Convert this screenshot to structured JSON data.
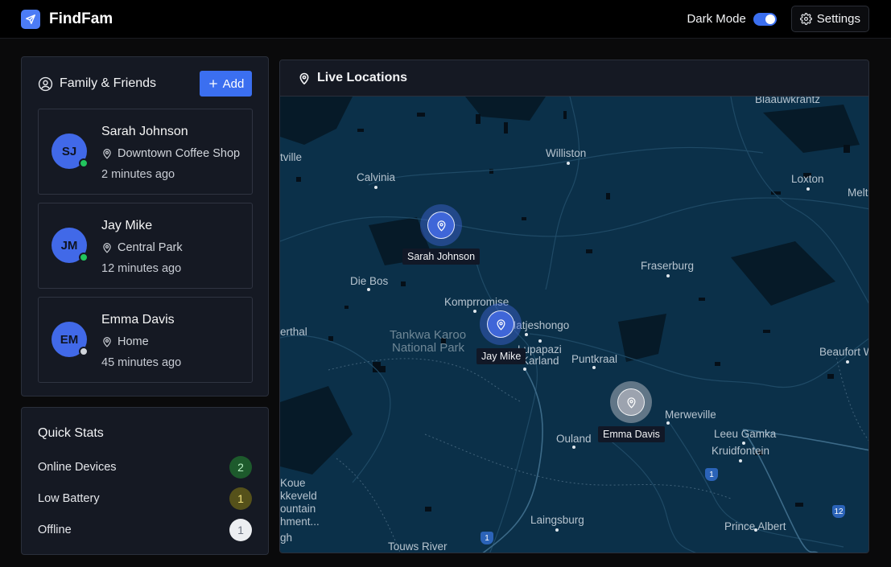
{
  "app": {
    "name": "FindFam"
  },
  "header": {
    "dark_mode_label": "Dark Mode",
    "dark_mode_on": true,
    "settings_label": "Settings"
  },
  "family_panel": {
    "title": "Family & Friends",
    "add_label": "Add",
    "members": [
      {
        "initials": "SJ",
        "name": "Sarah Johnson",
        "location": "Downtown Coffee Shop",
        "time": "2 minutes ago",
        "status": "online",
        "status_color": "#22c55e"
      },
      {
        "initials": "JM",
        "name": "Jay Mike",
        "location": "Central Park",
        "time": "12 minutes ago",
        "status": "online",
        "status_color": "#22c55e"
      },
      {
        "initials": "EM",
        "name": "Emma Davis",
        "location": "Home",
        "time": "45 minutes ago",
        "status": "offline",
        "status_color": "#d1d5db"
      }
    ]
  },
  "quick_stats": {
    "title": "Quick Stats",
    "rows": [
      {
        "label": "Online Devices",
        "value": "2",
        "bg": "#1d5a2c",
        "fg": "#b8f0c4"
      },
      {
        "label": "Low Battery",
        "value": "1",
        "bg": "#55511a",
        "fg": "#f2e27b"
      },
      {
        "label": "Offline",
        "value": "1",
        "bg": "#eceef1",
        "fg": "#6b7280"
      }
    ]
  },
  "map": {
    "title": "Live Locations",
    "markers": [
      {
        "name": "Sarah Johnson",
        "color": "#3f66d8"
      },
      {
        "name": "Jay Mike",
        "color": "#3f66d8"
      },
      {
        "name": "Emma Davis",
        "color": "#9ca3af"
      }
    ],
    "places": [
      "Blaauwkrantz",
      "tville",
      "Williston",
      "Calvinia",
      "Loxton",
      "Melt",
      "Fraserburg",
      "Die Bos",
      "Komprromise",
      "Matjeshongo",
      "erthal",
      "Tankwa Karoo",
      "National Park",
      "Lupapazi",
      "Karland",
      "Puntkraal",
      "Beaufort We",
      "Merweville",
      "Ouland",
      "Leeu Gamka",
      "Kruidfontein",
      "Koue",
      "kkeveld",
      "ountain",
      "hment...",
      "gh",
      "Laingsburg",
      "Prince Albert",
      "Touws River"
    ],
    "road_shields": [
      "1",
      "12",
      "1"
    ]
  },
  "colors": {
    "accent": "#3b6ff0",
    "map_water": "#0b3049"
  }
}
